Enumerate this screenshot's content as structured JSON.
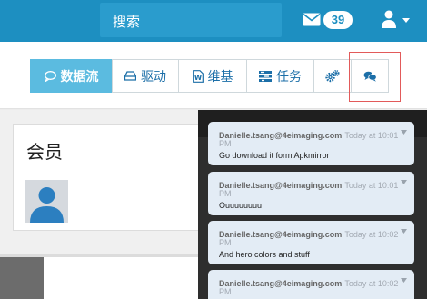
{
  "topbar": {
    "search_label": "搜索",
    "mail_count": "39",
    "background": "#1d8fc1"
  },
  "toolbar": {
    "tabs": [
      {
        "label": "数据流",
        "icon": "chat-bubble-icon",
        "active": true
      },
      {
        "label": "驱动",
        "icon": "drive-icon"
      },
      {
        "label": "维基",
        "icon": "wiki-icon"
      },
      {
        "label": "任务",
        "icon": "tasks-icon"
      },
      {
        "label": "",
        "icon": "gears-icon"
      },
      {
        "label": "",
        "icon": "comments-icon"
      }
    ],
    "accent": "#5bbbe0",
    "highlight_color": "#e25a5a"
  },
  "member_card": {
    "title": "会员"
  },
  "chat": {
    "messages": [
      {
        "sender": "Danielle.tsang@4eimaging.com",
        "time": "Today at 10:01",
        "time_wrap": "PM",
        "text": "Go download it form Apkmirror"
      },
      {
        "sender": "Danielle.tsang@4eimaging.com",
        "time": "Today at 10:01",
        "time_wrap": "PM",
        "text": "Ouuuuuuuu"
      },
      {
        "sender": "Danielle.tsang@4eimaging.com",
        "time": "Today at 10:02",
        "time_wrap": "PM",
        "text": "And hero colors and stuff"
      },
      {
        "sender": "Danielle.tsang@4eimaging.com",
        "time": "Today at 10:02",
        "time_wrap": "PM",
        "text": ""
      }
    ]
  }
}
